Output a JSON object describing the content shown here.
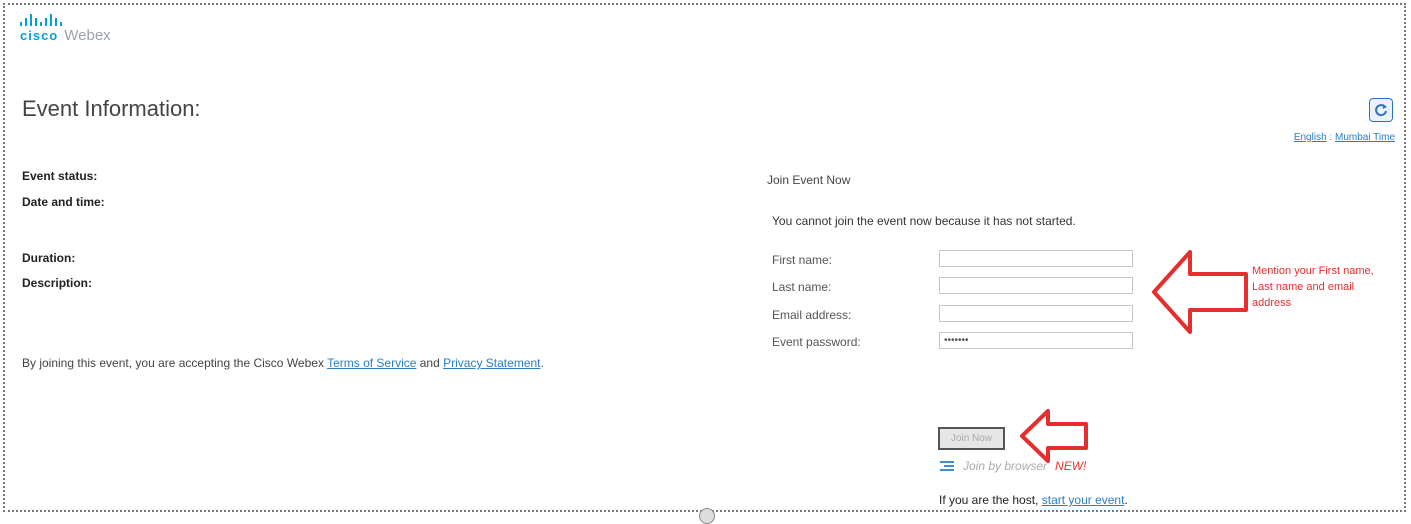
{
  "app": {
    "brand": "cisco",
    "product": "Webex"
  },
  "page_title": "Event Information:",
  "top_links": {
    "language": "English",
    "separator": " : ",
    "timezone": "Mumbai Time"
  },
  "event_info": {
    "status_label": "Event status:",
    "date_label": "Date and time:",
    "duration_label": "Duration:",
    "description_label": "Description:"
  },
  "terms": {
    "prefix": "By joining this event, you are accepting the Cisco Webex ",
    "terms_link": "Terms of Service",
    "and": " and ",
    "privacy_link": "Privacy Statement",
    "suffix": "."
  },
  "join": {
    "heading": "Join Event Now",
    "message": "You cannot join the event now because it has not started.",
    "fields": [
      {
        "label": "First name:",
        "value": ""
      },
      {
        "label": "Last name:",
        "value": ""
      },
      {
        "label": "Email address:",
        "value": ""
      },
      {
        "label": "Event password:",
        "value": "•••••••"
      }
    ],
    "button_label": "Join Now",
    "browser_label": "Join by browser",
    "new_tag": "NEW!",
    "host_prefix": "If you are the host, ",
    "host_link": "start your event",
    "host_suffix": "."
  },
  "annotation": {
    "text": "Mention your First name, Last name and email address"
  },
  "colors": {
    "accent": "#2a7dc7",
    "annotation_red": "#e52e2e",
    "cisco_blue": "#049fd9"
  }
}
